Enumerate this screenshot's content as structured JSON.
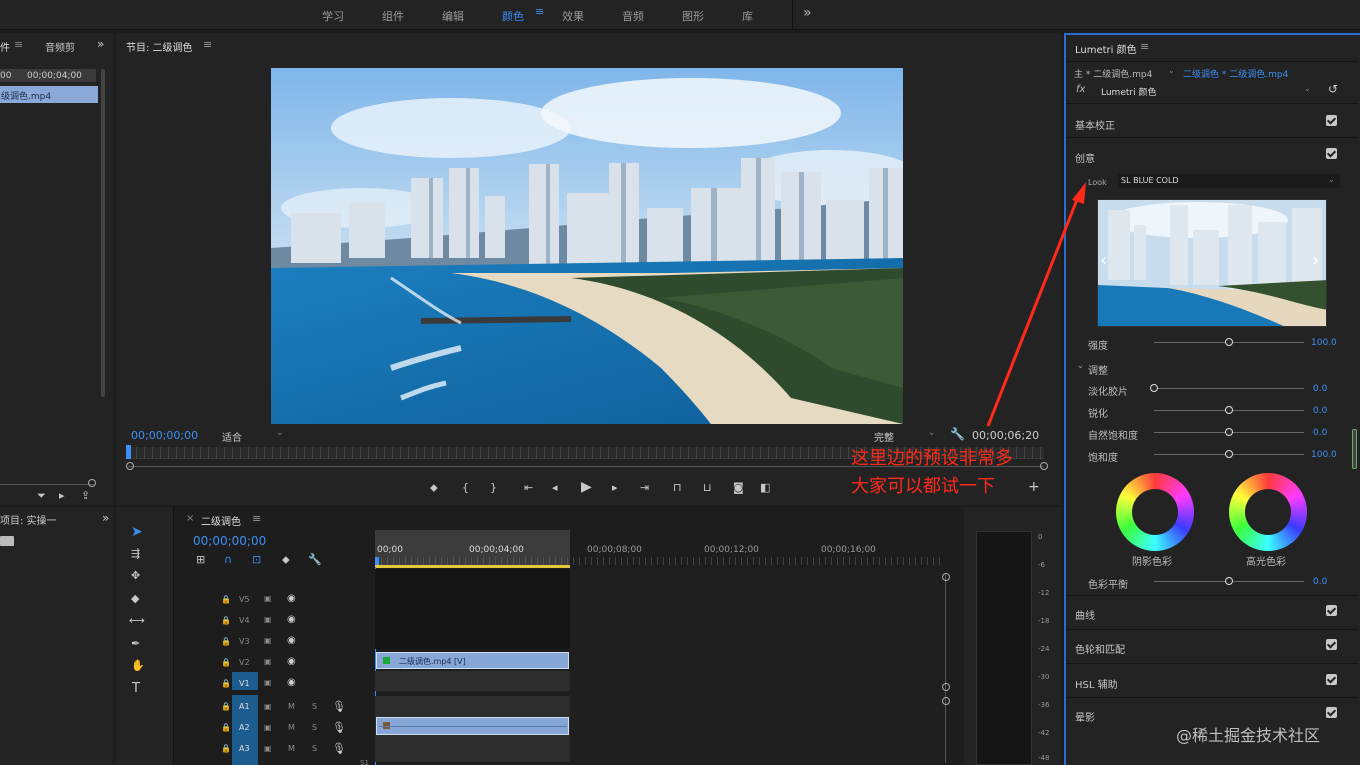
{
  "workspaces": [
    "学习",
    "组件",
    "编辑",
    "颜色",
    "效果",
    "音频",
    "图形",
    "库"
  ],
  "active_workspace": "颜色",
  "project": {
    "tab1": "件",
    "tab2": "音频剪",
    "timecode_a": "00",
    "timecode_b": "00;00;04;00",
    "file": "级调色.mp4",
    "bottom_title": "项目: 实操一"
  },
  "program": {
    "title": "节目: 二级调色",
    "timecode_left": "00;00;00;00",
    "fit": "适合",
    "quality": "完整",
    "timecode_right": "00;00;06;20"
  },
  "timeline": {
    "title": "二级调色",
    "timecode": "00;00;00;00",
    "ruler": [
      "00;00",
      "00;00;04;00",
      "00;00;08;00",
      "00;00;12;00",
      "00;00;16;00"
    ],
    "video_tracks": [
      "V5",
      "V4",
      "V3",
      "V2",
      "V1"
    ],
    "audio_tracks": [
      "A1",
      "A2",
      "A3"
    ],
    "clip_label": "二级调色.mp4 [V]",
    "track_mute": "M",
    "track_solo": "S",
    "meter_ticks": [
      "0",
      "-6",
      "-12",
      "-18",
      "-24",
      "-30",
      "-36",
      "-42",
      "-48"
    ],
    "extra": "S1"
  },
  "lumetri": {
    "panel_title": "Lumetri 颜色",
    "source": "主 * 二级调色.mp4",
    "sequence": "二级调色 * 二级调色.mp4",
    "fx_label": "fx",
    "effect": "Lumetri 颜色",
    "sections": {
      "basic": "基本校正",
      "creative": "创意",
      "curves": "曲线",
      "wheels": "色轮和匹配",
      "hsl": "HSL 辅助",
      "vignette": "晕影"
    },
    "look_label": "Look",
    "look_value": "SL BLUE COLD",
    "intensity": {
      "label": "强度",
      "value": "100.0",
      "level": 0.5
    },
    "adjust": "调整",
    "sliders": [
      {
        "label": "淡化胶片",
        "value": "0.0",
        "level": 0.0
      },
      {
        "label": "锐化",
        "value": "0.0",
        "level": 0.5
      },
      {
        "label": "自然饱和度",
        "value": "0.0",
        "level": 0.5
      },
      {
        "label": "饱和度",
        "value": "100.0",
        "level": 0.5
      }
    ],
    "shadow_wheel": "阴影色彩",
    "highlight_wheel": "高光色彩",
    "balance": {
      "label": "色彩平衡",
      "value": "0.0",
      "level": 0.5
    }
  },
  "annotation": {
    "line1": "这里边的预设非常多",
    "line2": "大家可以都试一下"
  },
  "watermark": "@稀土掘金技术社区",
  "colors": {
    "accent": "#3d8ff5",
    "annotation": "#ff2a1a",
    "panel": "#232323"
  }
}
